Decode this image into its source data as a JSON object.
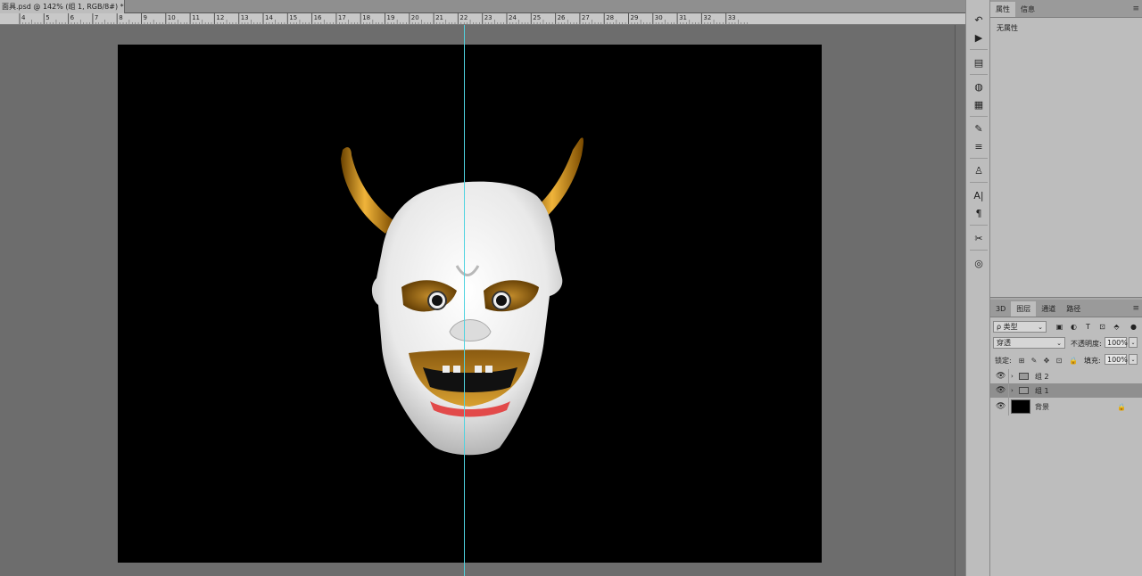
{
  "document": {
    "tab_title": "面具.psd @ 142% (组 1, RGB/8#) *",
    "close_glyph": "×",
    "ruler_ticks": [
      "4",
      "5",
      "6",
      "7",
      "8",
      "9",
      "10",
      "11",
      "12",
      "13",
      "14",
      "15",
      "16",
      "17",
      "18",
      "19",
      "20",
      "21",
      "22",
      "23",
      "24",
      "25",
      "26",
      "27",
      "28",
      "29",
      "30",
      "31",
      "32",
      "33"
    ]
  },
  "toolstrip": {
    "icons": [
      "history-icon",
      "play-icon",
      "levels-icon",
      "color-wheel-icon",
      "swatches-grid-icon",
      "brush-icon",
      "sliders-icon",
      "clone-stamp-icon",
      "character-icon",
      "paragraph-icon",
      "tools-icon",
      "cc-libraries-icon"
    ],
    "glyphs": [
      "↶",
      "▶",
      "▤",
      "◍",
      "▦",
      "✎",
      "≡",
      "♙",
      "A|",
      "¶",
      "✂",
      "◎"
    ]
  },
  "properties_panel": {
    "tabs": [
      "属性",
      "信息"
    ],
    "menu_glyph": "≡",
    "body_text": "无属性"
  },
  "layers_panel": {
    "tabs": [
      "3D",
      "图层",
      "通道",
      "路径"
    ],
    "menu_glyph": "≡",
    "filter_label": "ρ 类型",
    "filter_icons": [
      "▣",
      "◐",
      "T",
      "⊡",
      "⬘"
    ],
    "blend_mode": "穿透",
    "opacity_label": "不透明度:",
    "opacity_value": "100%",
    "lock_label": "锁定:",
    "lock_icons": [
      "⊞",
      "✎",
      "✥",
      "⊡",
      "🔒"
    ],
    "fill_label": "填充:",
    "fill_value": "100%",
    "layers": [
      {
        "name": "组 2",
        "type": "group",
        "selected": false
      },
      {
        "name": "组 1",
        "type": "group",
        "selected": true
      },
      {
        "name": "背景",
        "type": "background",
        "selected": false,
        "locked": true
      }
    ],
    "eye_glyph": "👁",
    "expand_glyph": "›"
  },
  "colors": {
    "canvas_bg": "#000000",
    "guide": "#4fd3e0",
    "mask_white": "#f2f2f2",
    "horn_gold": "#c88a10",
    "mouth_red": "#e24a4a"
  }
}
